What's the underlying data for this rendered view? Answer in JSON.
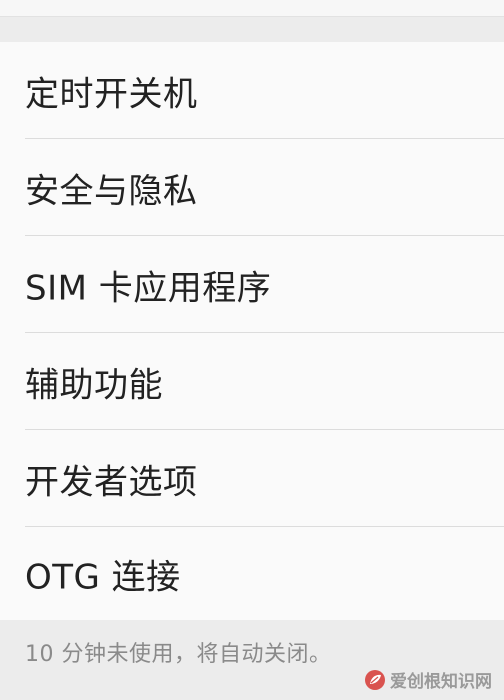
{
  "menu": {
    "items": [
      {
        "label": "定时开关机"
      },
      {
        "label": "安全与隐私"
      },
      {
        "label": "SIM 卡应用程序"
      },
      {
        "label": "辅助功能"
      },
      {
        "label": "开发者选项"
      },
      {
        "label": "OTG 连接"
      }
    ]
  },
  "footer": {
    "note": "10 分钟未使用，将自动关闭。"
  },
  "watermark": {
    "text": "爱创根知识网",
    "icon": "leaf-logo-icon",
    "color": "#d9534f"
  }
}
